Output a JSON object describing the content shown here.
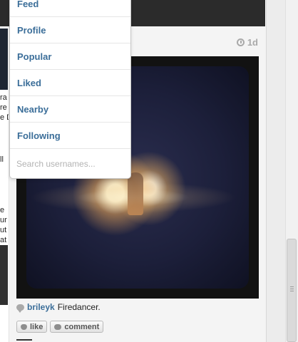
{
  "menu": {
    "items": [
      {
        "label": "Feed"
      },
      {
        "label": "Profile"
      },
      {
        "label": "Popular"
      },
      {
        "label": "Liked"
      },
      {
        "label": "Nearby"
      },
      {
        "label": "Following"
      }
    ],
    "search_placeholder": "Search usernames..."
  },
  "post": {
    "time_ago": "1d",
    "username": "brileyk",
    "caption": "Firedancer.",
    "like_label": "like",
    "comment_label": "comment"
  },
  "background_fragments": [
    "ra",
    "re",
    "e D",
    "ll",
    "e",
    "ur",
    "ut",
    "at"
  ],
  "colors": {
    "link": "#3b6e99",
    "muted": "#a9a9a9",
    "header": "#2b2b2b"
  }
}
